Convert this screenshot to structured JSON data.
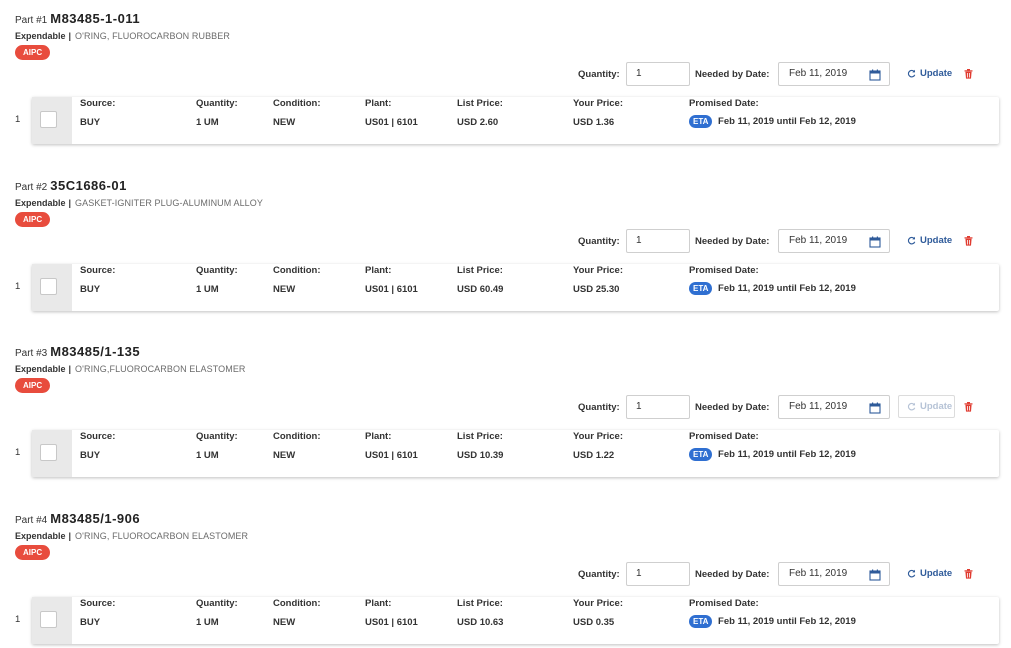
{
  "labels": {
    "part_prefix": "Part #",
    "quantity": "Quantity:",
    "needed_by": "Needed by Date:",
    "update": "Update",
    "source": "Source:",
    "line_quantity": "Quantity:",
    "condition": "Condition:",
    "plant": "Plant:",
    "list_price": "List Price:",
    "your_price": "Your Price:",
    "promised_date": "Promised Date:",
    "eta": "ETA"
  },
  "colors": {
    "badge": "#e84c3d",
    "link": "#2f5b9a",
    "eta": "#2f6fd1",
    "trash": "#e03c31"
  },
  "parts": [
    {
      "index": "1",
      "number_label": "Part #1",
      "part_number": "M83485-1-011",
      "type": "Expendable",
      "description": "O'RING, FLUOROCARBON RUBBER",
      "badge": "AIPC",
      "quantity": "1",
      "needed_by": "Feb 11, 2019",
      "update_enabled": true,
      "line": {
        "row": "1",
        "source": "BUY",
        "quantity": "1 UM",
        "condition": "NEW",
        "plant": "US01 | 6101",
        "list_price": "USD 2.60",
        "your_price": "USD 1.36",
        "promised": "Feb 11, 2019 until Feb 12, 2019"
      }
    },
    {
      "index": "2",
      "number_label": "Part #2",
      "part_number": "35C1686-01",
      "type": "Expendable",
      "description": "GASKET-IGNITER PLUG-ALUMINUM ALLOY",
      "badge": "AIPC",
      "quantity": "1",
      "needed_by": "Feb 11, 2019",
      "update_enabled": true,
      "line": {
        "row": "1",
        "source": "BUY",
        "quantity": "1 UM",
        "condition": "NEW",
        "plant": "US01 | 6101",
        "list_price": "USD 60.49",
        "your_price": "USD 25.30",
        "promised": "Feb 11, 2019 until Feb 12, 2019"
      }
    },
    {
      "index": "3",
      "number_label": "Part #3",
      "part_number": "M83485/1-135",
      "type": "Expendable",
      "description": "O'RING,FLUOROCARBON ELASTOMER",
      "badge": "AIPC",
      "quantity": "1",
      "needed_by": "Feb 11, 2019",
      "update_enabled": false,
      "line": {
        "row": "1",
        "source": "BUY",
        "quantity": "1 UM",
        "condition": "NEW",
        "plant": "US01 | 6101",
        "list_price": "USD 10.39",
        "your_price": "USD 1.22",
        "promised": "Feb 11, 2019 until Feb 12, 2019"
      }
    },
    {
      "index": "4",
      "number_label": "Part #4",
      "part_number": "M83485/1-906",
      "type": "Expendable",
      "description": "O'RING, FLUOROCARBON ELASTOMER",
      "badge": "AIPC",
      "quantity": "1",
      "needed_by": "Feb 11, 2019",
      "update_enabled": true,
      "line": {
        "row": "1",
        "source": "BUY",
        "quantity": "1 UM",
        "condition": "NEW",
        "plant": "US01 | 6101",
        "list_price": "USD 10.63",
        "your_price": "USD 0.35",
        "promised": "Feb 11, 2019 until Feb 12, 2019"
      }
    }
  ]
}
